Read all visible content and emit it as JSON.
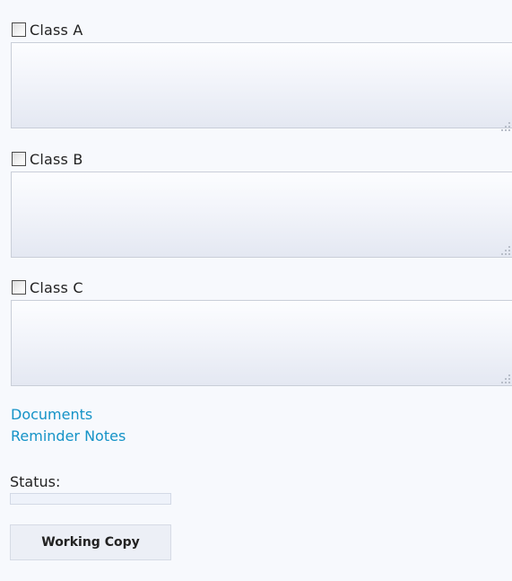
{
  "classes": [
    {
      "label": "Class A",
      "checked": false,
      "notes": ""
    },
    {
      "label": "Class B",
      "checked": false,
      "notes": ""
    },
    {
      "label": "Class C",
      "checked": false,
      "notes": ""
    }
  ],
  "links": {
    "documents": "Documents",
    "reminder_notes": "Reminder Notes"
  },
  "status": {
    "label": "Status:",
    "progress_percent": 0
  },
  "actions": {
    "working_copy_label": "Working Copy"
  },
  "colors": {
    "link": "#1593c7",
    "background": "#f7f9fd"
  }
}
